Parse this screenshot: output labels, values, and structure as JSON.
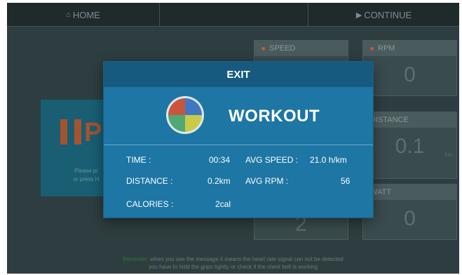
{
  "topbar": {
    "home_icon": "home-icon",
    "home_label": "HOME",
    "continue_icon": "play-icon",
    "continue_label": "CONTINUE"
  },
  "background": {
    "pause_letter": "P",
    "pause_hint_line1": "Please pr",
    "pause_hint_line2": "or press H",
    "tiles": {
      "speed": {
        "label": "SPEED",
        "value": ""
      },
      "rpm": {
        "label": "RPM",
        "value": "0"
      },
      "distance": {
        "label": "DISTANCE",
        "value": "0.1",
        "unit": "km"
      },
      "level": {
        "label": "",
        "value": "2"
      },
      "watt": {
        "label": "WATT",
        "value": "0"
      }
    },
    "hint_highlight": "Reminder:",
    "hint_line1": "when you see the message it means the heart rate signal can not be detected",
    "hint_line2": "you have to hold the grips tightly or check if the chest belt is working"
  },
  "modal": {
    "title": "EXIT",
    "heading": "WORKOUT",
    "stats": {
      "time_label": "TIME :",
      "time_value": "00:34",
      "distance_label": "DISTANCE :",
      "distance_value": "0.2km",
      "calories_label": "CALORIES :",
      "calories_value": "2cal",
      "avg_speed_label": "AVG SPEED :",
      "avg_speed_value": "21.0 h/km",
      "avg_rpm_label": "AVG RPM :",
      "avg_rpm_value": "56"
    }
  },
  "colors": {
    "modal_bg": "#1d76a4",
    "modal_header": "#165a7f",
    "pie": [
      "#3f78c0",
      "#c9c94a",
      "#4fa876",
      "#c9563c"
    ]
  }
}
